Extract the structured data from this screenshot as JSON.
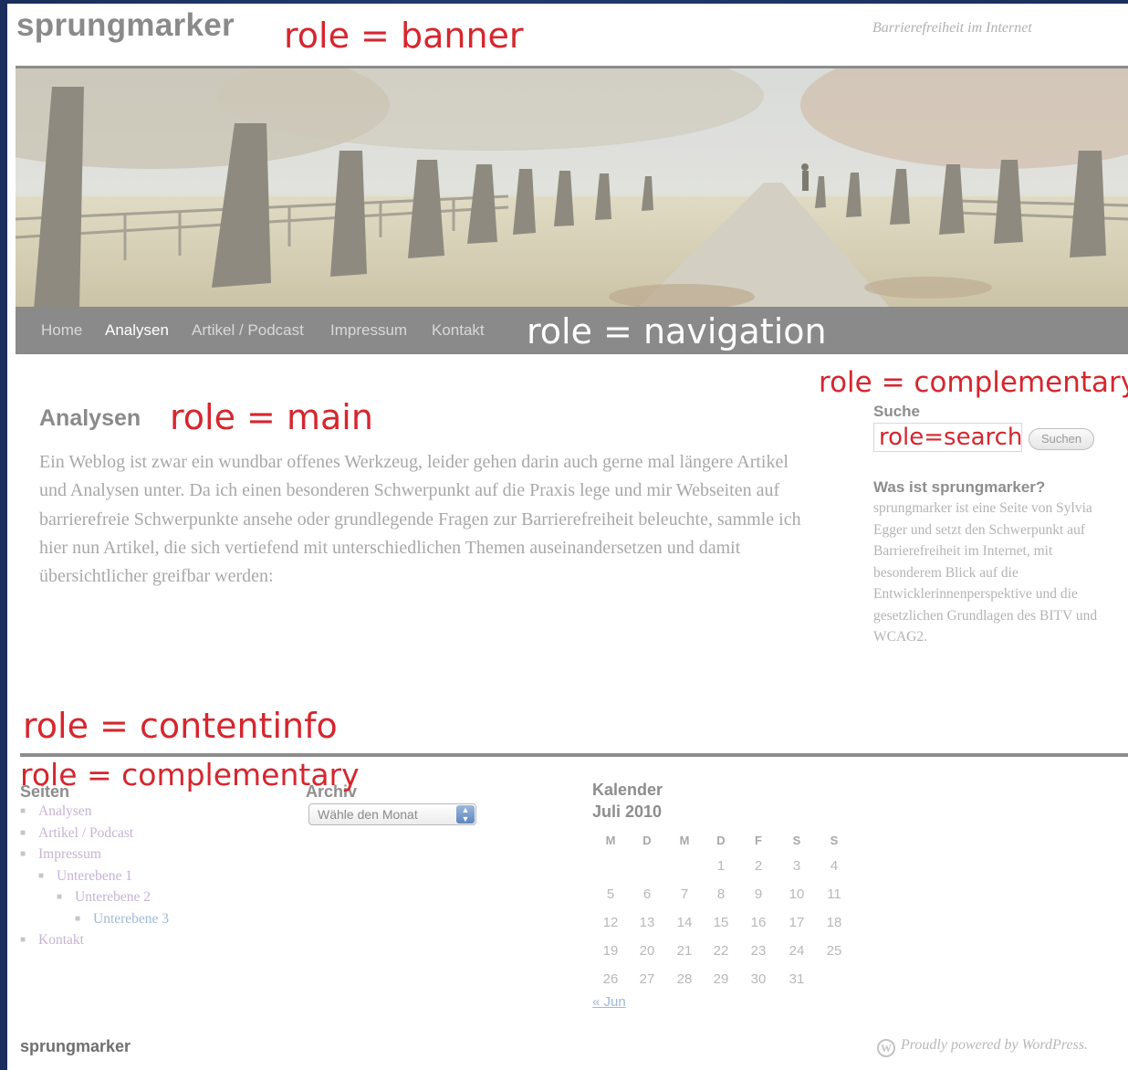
{
  "header": {
    "site_title": "sprungmarker",
    "tagline": "Barrierefreiheit im Internet",
    "role_label": "role = banner"
  },
  "navigation": {
    "role_label": "role = navigation",
    "items": [
      {
        "label": "Home",
        "active": false
      },
      {
        "label": "Analysen",
        "active": true
      },
      {
        "label": "Artikel / Podcast",
        "active": false
      },
      {
        "label": "Impressum",
        "active": false
      },
      {
        "label": "Kontakt",
        "active": false
      }
    ]
  },
  "main": {
    "role_label": "role = main",
    "title": "Analysen",
    "text": "Ein Weblog ist zwar ein wundbar offenes Werkzeug, leider gehen darin auch gerne mal längere Artikel und Analysen unter. Da ich einen besonderen Schwerpunkt auf die Praxis lege und mir Webseiten auf barrierefreie Schwerpunkte ansehe oder grundlegende Fragen zur Barrierefreiheit beleuchte, sammle ich hier nun Artikel, die sich vertiefend mit unterschiedlichen Themen auseinandersetzen und damit übersichtlicher greifbar werden:"
  },
  "sidebar": {
    "role_label": "role = complementary",
    "search_title": "Suche",
    "search_role_label": "role=search",
    "search_button": "Suchen",
    "about_title": "Was ist sprungmarker?",
    "about_text": "sprungmarker ist eine Seite von Sylvia Egger und setzt den Schwerpunkt auf Barrierefreiheit im Internet, mit besonderem Blick auf die Entwicklerinnenperspektive und die gesetzlichen Grundlagen des BITV und WCAG2."
  },
  "footer": {
    "contentinfo_label": "role = contentinfo",
    "complementary_label": "role = complementary",
    "pages_title": "Seiten",
    "pages": [
      {
        "label": "Analysen",
        "level": 0
      },
      {
        "label": "Artikel / Podcast",
        "level": 0
      },
      {
        "label": "Impressum",
        "level": 0
      },
      {
        "label": "Unterebene 1",
        "level": 1
      },
      {
        "label": "Unterebene 2",
        "level": 2
      },
      {
        "label": "Unterebene 3",
        "level": 3
      },
      {
        "label": "Kontakt",
        "level": 0
      }
    ],
    "archive_title": "Archiv",
    "archive_select": "Wähle den Monat",
    "calendar_title": "Kalender",
    "calendar_caption": "Juli 2010",
    "weekdays": [
      "M",
      "D",
      "M",
      "D",
      "F",
      "S",
      "S"
    ],
    "weeks": [
      [
        "",
        "",
        "",
        "1",
        "2",
        "3",
        "4"
      ],
      [
        "5",
        "6",
        "7",
        "8",
        "9",
        "10",
        "11"
      ],
      [
        "12",
        "13",
        "14",
        "15",
        "16",
        "17",
        "18"
      ],
      [
        "19",
        "20",
        "21",
        "22",
        "23",
        "24",
        "25"
      ],
      [
        "26",
        "27",
        "28",
        "29",
        "30",
        "31",
        ""
      ]
    ],
    "calendar_prev": "« Jun",
    "site_name": "sprungmarker",
    "credit": "Proudly powered by WordPress."
  },
  "colors": {
    "role_annotation": "#d6262e",
    "nav_background": "#8a8a8a",
    "outer_background": "#1c2f5c",
    "link_visited": "#c7b3d4",
    "link": "#9fbad6"
  }
}
